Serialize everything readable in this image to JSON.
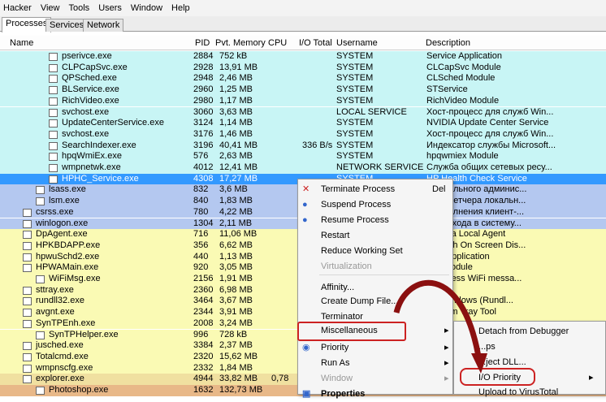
{
  "menubar": [
    "Hacker",
    "View",
    "Tools",
    "Users",
    "Window",
    "Help"
  ],
  "tabs": [
    "Processes",
    "Services",
    "Network"
  ],
  "columns": [
    "Name",
    "PID",
    "Pvt. Memory",
    "CPU",
    "I/O Total",
    "Username",
    "Description"
  ],
  "rows": [
    {
      "name": "pserivce.exe",
      "pid": "2884",
      "mem": "752 kB",
      "cpu": "",
      "io": "",
      "user": "SYSTEM",
      "desc": "Service Application"
    },
    {
      "name": "CLPCapSvc.exe",
      "pid": "2928",
      "mem": "13,91 MB",
      "cpu": "",
      "io": "",
      "user": "SYSTEM",
      "desc": "CLCapSvc Module"
    },
    {
      "name": "QPSched.exe",
      "pid": "2948",
      "mem": "2,46 MB",
      "cpu": "",
      "io": "",
      "user": "SYSTEM",
      "desc": "CLSched Module"
    },
    {
      "name": "BLService.exe",
      "pid": "2960",
      "mem": "1,25 MB",
      "cpu": "",
      "io": "",
      "user": "SYSTEM",
      "desc": "STService"
    },
    {
      "name": "RichVideo.exe",
      "pid": "2980",
      "mem": "1,17 MB",
      "cpu": "",
      "io": "",
      "user": "SYSTEM",
      "desc": "RichVideo Module"
    },
    {
      "name": "svchost.exe",
      "pid": "3060",
      "mem": "3,63 MB",
      "cpu": "",
      "io": "",
      "user": "LOCAL SERVICE",
      "desc": "Хост-процесс для служб Win..."
    },
    {
      "name": "UpdateCenterService.exe",
      "pid": "3124",
      "mem": "1,14 MB",
      "cpu": "",
      "io": "",
      "user": "SYSTEM",
      "desc": "NVIDIA Update Center Service"
    },
    {
      "name": "svchost.exe",
      "pid": "3176",
      "mem": "1,46 MB",
      "cpu": "",
      "io": "",
      "user": "SYSTEM",
      "desc": "Хост-процесс для служб Win..."
    },
    {
      "name": "SearchIndexer.exe",
      "pid": "3196",
      "mem": "40,41 MB",
      "cpu": "",
      "io": "336 B/s",
      "user": "SYSTEM",
      "desc": "Индексатор службы Microsoft..."
    },
    {
      "name": "hpqWmiEx.exe",
      "pid": "576",
      "mem": "2,63 MB",
      "cpu": "",
      "io": "",
      "user": "SYSTEM",
      "desc": "hpqwmiex Module"
    },
    {
      "name": "wmpnetwk.exe",
      "pid": "4012",
      "mem": "12,41 MB",
      "cpu": "",
      "io": "",
      "user": "NETWORK SERVICE",
      "desc": "Служба общих сетевых ресу..."
    },
    {
      "name": "HPHC_Service.exe",
      "pid": "4308",
      "mem": "17,27 MB",
      "cpu": "",
      "io": "",
      "user": "SYSTEM",
      "desc": "HP Health Check Service"
    },
    {
      "name": "lsass.exe",
      "pid": "832",
      "mem": "3,6 MB",
      "cpu": "",
      "io": "",
      "user": "",
      "desc": "...локального админис..."
    },
    {
      "name": "lsm.exe",
      "pid": "840",
      "mem": "1,83 MB",
      "cpu": "",
      "io": "",
      "user": "",
      "desc": "...диспетчера локальн..."
    },
    {
      "name": "csrss.exe",
      "pid": "780",
      "mem": "4,22 MB",
      "cpu": "",
      "io": "",
      "user": "",
      "desc": "...исполнения клиент-..."
    },
    {
      "name": "winlogon.exe",
      "pid": "1304",
      "mem": "2,11 MB",
      "cpu": "",
      "io": "",
      "user": "",
      "desc": "...ма входа в систему..."
    },
    {
      "name": "DpAgent.exe",
      "pid": "716",
      "mem": "11,06 MB",
      "cpu": "",
      "io": "",
      "user": "",
      "desc": "...rsona Local Agent"
    },
    {
      "name": "HPKBDAPP.exe",
      "pid": "356",
      "mem": "6,62 MB",
      "cpu": "",
      "io": "",
      "user": "",
      "desc": "...Touch On Screen Dis..."
    },
    {
      "name": "hpwuSchd2.exe",
      "pid": "440",
      "mem": "1,13 MB",
      "cpu": "",
      "io": "",
      "user": "",
      "desc": "...ed Application"
    },
    {
      "name": "HPWAMain.exe",
      "pid": "920",
      "mem": "3,05 MB",
      "cpu": "",
      "io": "",
      "user": "",
      "desc": "...in Module"
    },
    {
      "name": "WiFiMsg.exe",
      "pid": "2156",
      "mem": "1,91 MB",
      "cpu": "",
      "io": "",
      "user": "",
      "desc": "...process WiFi messa..."
    },
    {
      "name": "sttray.exe",
      "pid": "2360",
      "mem": "6,98 MB",
      "cpu": "",
      "io": "",
      "user": "",
      "desc": "...dio"
    },
    {
      "name": "rundll32.exe",
      "pid": "3464",
      "mem": "3,67 MB",
      "cpu": "",
      "io": "",
      "user": "",
      "desc": "...с Windows (Rundl..."
    },
    {
      "name": "avgnt.exe",
      "pid": "2344",
      "mem": "3,91 MB",
      "cpu": "",
      "io": "",
      "user": "",
      "desc": "...ystem Tray Tool"
    },
    {
      "name": "SynTPEnh.exe",
      "pid": "2008",
      "mem": "3,24 MB",
      "cpu": "",
      "io": "",
      "user": "",
      "desc": ""
    },
    {
      "name": "SynTPHelper.exe",
      "pid": "996",
      "mem": "728 kB",
      "cpu": "",
      "io": "",
      "user": "",
      "desc": ""
    },
    {
      "name": "jusched.exe",
      "pid": "3384",
      "mem": "2,37 MB",
      "cpu": "",
      "io": "",
      "user": "",
      "desc": ""
    },
    {
      "name": "Totalcmd.exe",
      "pid": "2320",
      "mem": "15,62 MB",
      "cpu": "",
      "io": "",
      "user": "",
      "desc": ""
    },
    {
      "name": "wmpnscfg.exe",
      "pid": "2332",
      "mem": "1,84 MB",
      "cpu": "",
      "io": "",
      "user": "",
      "desc": ""
    },
    {
      "name": "explorer.exe",
      "pid": "4944",
      "mem": "33,82 MB",
      "cpu": "0,78",
      "io": "",
      "user": "",
      "desc": ""
    },
    {
      "name": "Photoshop.exe",
      "pid": "1632",
      "mem": "132,73 MB",
      "cpu": "",
      "io": "",
      "user": "",
      "desc": ""
    }
  ],
  "context_menu": {
    "items": [
      {
        "label": "Terminate Process",
        "shortcut": "Del",
        "icon": "x-icon"
      },
      {
        "label": "Suspend Process",
        "shortcut": "",
        "icon": "pause-icon"
      },
      {
        "label": "Resume Process",
        "shortcut": "",
        "icon": "play-icon"
      },
      {
        "label": "Restart",
        "shortcut": "",
        "icon": ""
      },
      {
        "label": "Reduce Working Set",
        "shortcut": "",
        "icon": ""
      },
      {
        "label": "Virtualization",
        "shortcut": "",
        "icon": ""
      },
      {
        "label": "Affinity...",
        "shortcut": "",
        "icon": ""
      },
      {
        "label": "Create Dump File...",
        "shortcut": "",
        "icon": ""
      },
      {
        "label": "Terminator",
        "shortcut": "",
        "icon": ""
      },
      {
        "label": "Miscellaneous",
        "shortcut": "",
        "icon": ""
      },
      {
        "label": "Priority",
        "shortcut": "",
        "icon": "priority-icon"
      },
      {
        "label": "Run As",
        "shortcut": "",
        "icon": ""
      },
      {
        "label": "Window",
        "shortcut": "",
        "icon": ""
      },
      {
        "label": "Properties",
        "shortcut": "",
        "icon": "properties-icon"
      }
    ]
  },
  "submenu": {
    "items": [
      {
        "label": "Detach from Debugger"
      },
      {
        "label": "...ps"
      },
      {
        "label": "...ject DLL..."
      },
      {
        "label": "I/O Priority"
      },
      {
        "label": "Upload to VirusTotal"
      }
    ]
  },
  "colors": {
    "service_cyan": "#c8f5f5",
    "system_blue": "#b4c8f0",
    "user_yellow": "#fafab4",
    "selected": "#3399ff",
    "highlight_red": "#cc2222",
    "photoshop_orange": "#e8b888"
  }
}
